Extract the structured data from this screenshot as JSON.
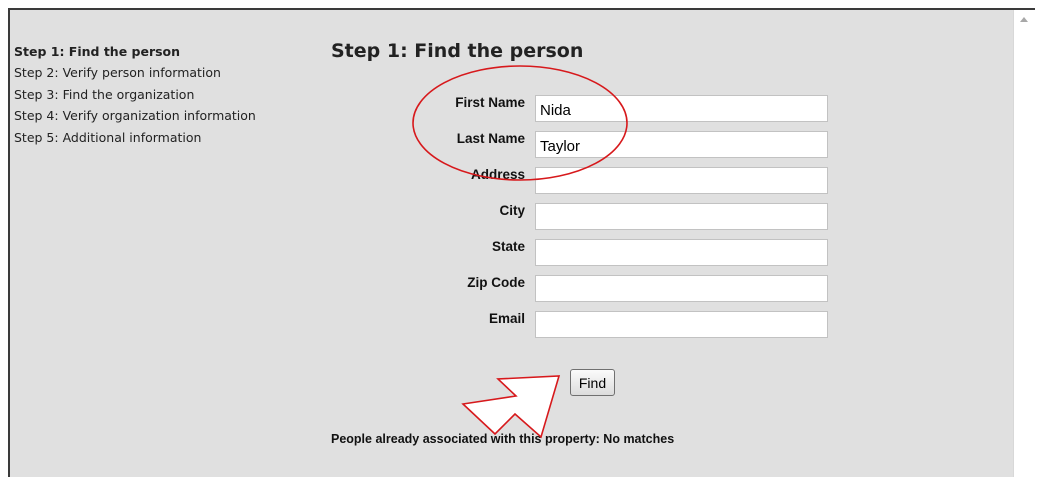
{
  "sidebar": {
    "steps": [
      {
        "label": "Step 1: Find the person",
        "active": true
      },
      {
        "label": "Step 2: Verify person information",
        "active": false
      },
      {
        "label": "Step 3: Find the organization",
        "active": false
      },
      {
        "label": "Step 4: Verify organization information",
        "active": false
      },
      {
        "label": "Step 5: Additional information",
        "active": false
      }
    ]
  },
  "main": {
    "heading": "Step 1: Find the person",
    "fields": [
      {
        "label": "First Name",
        "value": "Nida"
      },
      {
        "label": "Last Name",
        "value": "Taylor"
      },
      {
        "label": "Address",
        "value": ""
      },
      {
        "label": "City",
        "value": ""
      },
      {
        "label": "State",
        "value": ""
      },
      {
        "label": "Zip Code",
        "value": ""
      },
      {
        "label": "Email",
        "value": ""
      }
    ],
    "find_label": "Find",
    "status_text": "People already associated with this property: No matches"
  },
  "annotations": {
    "circle_color": "#d7191c",
    "arrow_color": "#d7191c"
  },
  "colors": {
    "window_background": "#e0e0e0",
    "input_background": "#ffffff"
  },
  "icons": {
    "scroll_up": "scroll-up-arrow-icon"
  }
}
